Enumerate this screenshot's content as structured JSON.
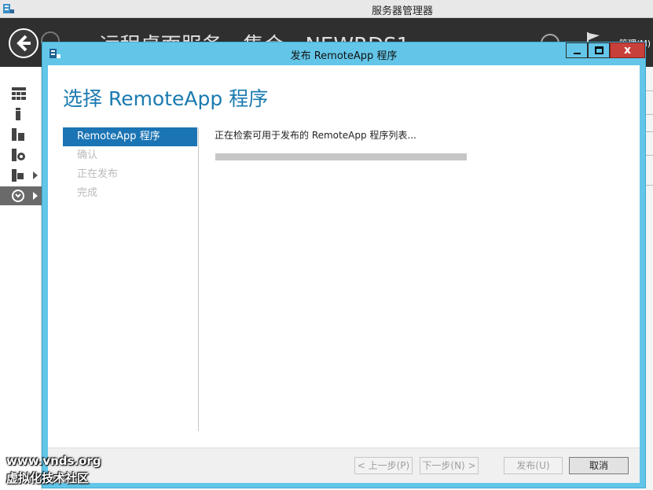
{
  "background_window": {
    "title": "服务器管理器",
    "breadcrumb": "▸ ◂ 远程桌面服务 › 集合 › NEWRDS1",
    "manage_label": "管理(M)"
  },
  "dialog": {
    "title": "发布 RemoteApp 程序",
    "close_glyph": "x",
    "heading": "选择 RemoteApp 程序",
    "steps": [
      {
        "label": "RemoteApp 程序",
        "active": true
      },
      {
        "label": "确认",
        "active": false
      },
      {
        "label": "正在发布",
        "active": false
      },
      {
        "label": "完成",
        "active": false
      }
    ],
    "status_text": "正在检索可用于发布的 RemoteApp 程序列表...",
    "progress_fraction": 1.0,
    "buttons": {
      "prev": "< 上一步(P)",
      "next": "下一步(N) >",
      "publish": "发布(U)",
      "cancel": "取消"
    }
  },
  "watermark": {
    "line1": "www.vnds.org",
    "line2": "虚拟化技术社区"
  }
}
